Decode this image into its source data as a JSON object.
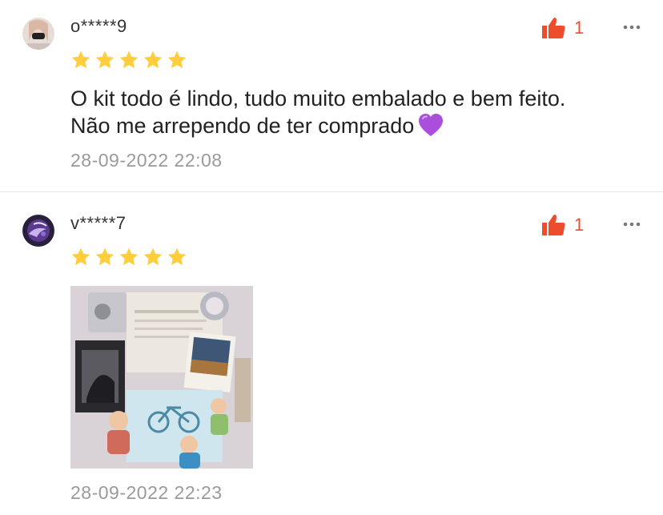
{
  "reviews": [
    {
      "username": "o*****9",
      "likes": "1",
      "rating": 5,
      "comment_line1": "O kit todo é lindo, tudo muito embalado e bem feito.",
      "comment_line2": "Não me arrependo de ter comprado",
      "emoji": "purple-heart",
      "date": "28-09-2022 22:08"
    },
    {
      "username": "v*****7",
      "likes": "1",
      "rating": 5,
      "photo": "review-photo",
      "date": "28-09-2022 22:23"
    }
  ],
  "colors": {
    "accent": "#ee4d2d",
    "star": "#ffce3d",
    "date_text": "#9a9a9a"
  }
}
